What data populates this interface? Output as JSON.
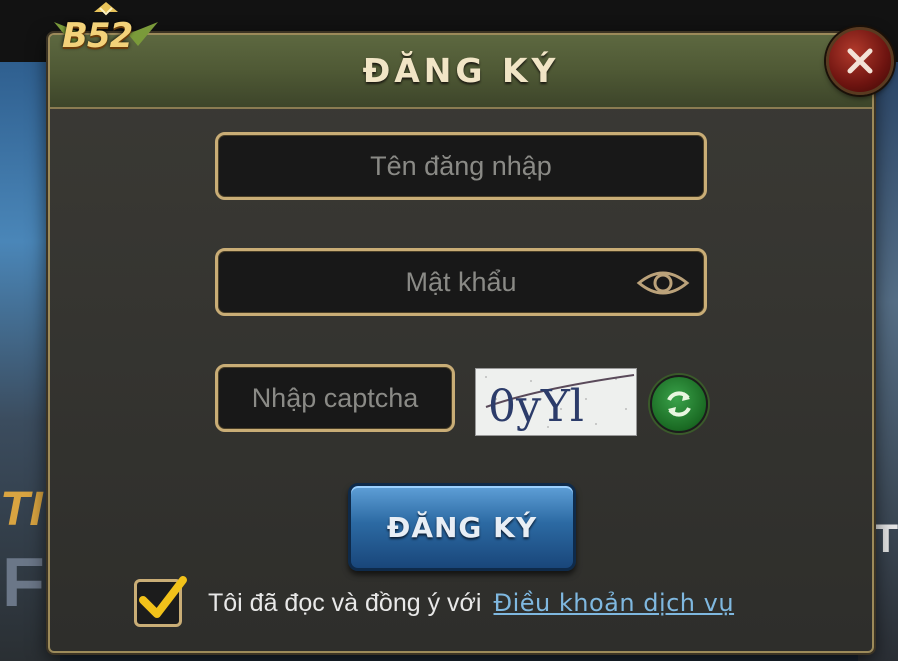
{
  "brand": {
    "logo_text": "B52"
  },
  "dialog": {
    "title": "ĐĂNG KÝ",
    "close_icon": "close-icon"
  },
  "form": {
    "username": {
      "placeholder": "Tên đăng nhập",
      "value": ""
    },
    "password": {
      "placeholder": "Mật khẩu",
      "value": "",
      "toggle_icon": "eye-icon"
    },
    "captcha": {
      "placeholder": "Nhập captcha",
      "value": "",
      "image_text": "0yYl",
      "refresh_icon": "refresh-icon"
    },
    "submit_label": "ĐĂNG KÝ",
    "agree": {
      "checked": true,
      "text": "Tôi đã đọc và đồng ý với",
      "link_text": "Điều khoản dịch vụ"
    }
  },
  "colors": {
    "accent_gold": "#c9ad76",
    "title_bar": "#4f5935",
    "submit_blue": "#2c6aa3",
    "link": "#7fb8e0",
    "close_red": "#8e1f17",
    "refresh_green": "#2a8a38"
  }
}
